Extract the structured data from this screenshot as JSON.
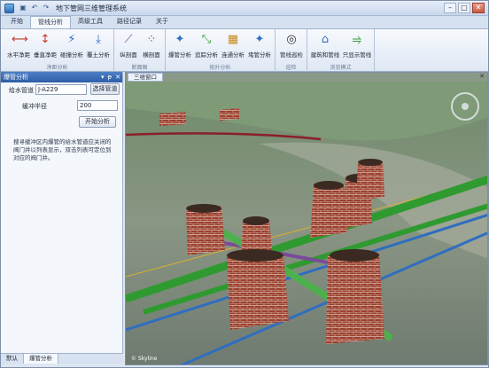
{
  "app": {
    "title": "地下管网三维管理系统"
  },
  "tabs": [
    {
      "label": "开始"
    },
    {
      "label": "管线分析"
    },
    {
      "label": "高级工具"
    },
    {
      "label": "路径记录"
    },
    {
      "label": "关于"
    }
  ],
  "ribbon": {
    "groups": [
      {
        "label": "净距分析",
        "buttons": [
          {
            "label": "水平净距",
            "icon": "horizontal-distance-icon"
          },
          {
            "label": "垂直净距",
            "icon": "vertical-distance-icon"
          },
          {
            "label": "碰撞分析",
            "icon": "collision-icon"
          },
          {
            "label": "覆土分析",
            "icon": "soil-cover-icon"
          }
        ]
      },
      {
        "label": "断面图",
        "buttons": [
          {
            "label": "纵剖面",
            "icon": "longitudinal-section-icon"
          },
          {
            "label": "横剖面",
            "icon": "cross-section-icon"
          }
        ]
      },
      {
        "label": "拓扑分析",
        "buttons": [
          {
            "label": "爆管分析",
            "icon": "burst-pipe-icon"
          },
          {
            "label": "追踪分析",
            "icon": "trace-icon"
          },
          {
            "label": "连通分析",
            "icon": "connectivity-icon"
          },
          {
            "label": "堵管分析",
            "icon": "blocked-pipe-icon"
          }
        ]
      },
      {
        "label": "巡检",
        "buttons": [
          {
            "label": "管线巡检",
            "icon": "inspection-icon"
          }
        ]
      },
      {
        "label": "浏览模式",
        "buttons": [
          {
            "label": "建筑和管线",
            "icon": "building-pipeline-icon"
          },
          {
            "label": "只显示管线",
            "icon": "pipeline-only-icon"
          }
        ]
      }
    ]
  },
  "panel": {
    "title": "爆管分析",
    "pipe_label": "给水管道",
    "pipe_value": "J-A229",
    "select_button": "选择管道",
    "buffer_label": "缓冲半径",
    "buffer_value": "200",
    "start_button": "开始分析",
    "note": "搜寻缓冲区内爆管的给水管道应关闭的阀门井以列表显示，双击列表可定位到对应的阀门井。",
    "controls": [
      "▾",
      "ᵽ",
      "✕"
    ]
  },
  "bottom_tabs": [
    {
      "label": "默认"
    },
    {
      "label": "爆管分析"
    }
  ],
  "viewport": {
    "tab": "三维窗口",
    "logo": "© Skyline"
  },
  "colors": {
    "pipe_green": "#2f9a2f",
    "pipe_blue": "#2f6ec0",
    "pipe_yellow": "#d8b030",
    "brick": "#9b3f2e",
    "accent": "#2d5ea6"
  }
}
